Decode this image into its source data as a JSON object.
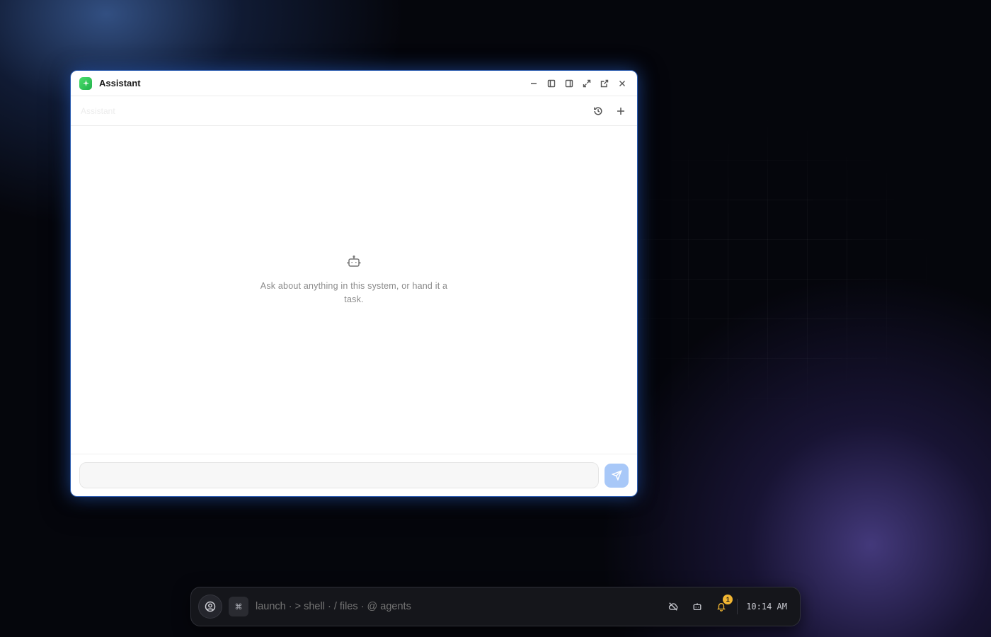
{
  "window": {
    "title": "Assistant",
    "app_icon": "sparkle-icon",
    "controls": [
      "minimize-icon",
      "sidebar-left-icon",
      "sidebar-right-icon",
      "maximize-icon",
      "open-external-icon",
      "close-icon"
    ]
  },
  "subheader": {
    "title": "Assistant",
    "actions": [
      "history-icon",
      "plus-icon"
    ]
  },
  "empty_state": {
    "icon": "robot-icon",
    "text": "Ask about anything in this system, or hand it a task."
  },
  "composer": {
    "placeholder": "",
    "value": "",
    "send_icon": "send-icon",
    "accent": "#a8c8f8"
  },
  "dock": {
    "avatar_icon": "user-circle-icon",
    "cmd_key": "⌘",
    "launcher_placeholder": "launch · > shell · / files · @ agents",
    "tray": [
      "cloud-off-icon",
      "robot-icon",
      "bell-icon"
    ],
    "notification_count": "1",
    "clock": "10:14 AM",
    "badge_color": "#f2b632"
  }
}
